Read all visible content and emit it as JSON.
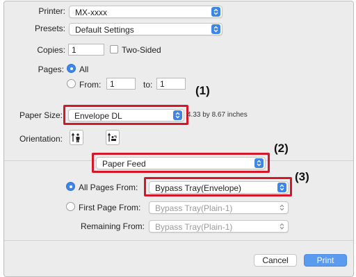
{
  "printer": {
    "label": "Printer:",
    "value": "MX-xxxx"
  },
  "presets": {
    "label": "Presets:",
    "value": "Default Settings"
  },
  "copies": {
    "label": "Copies:",
    "value": "1",
    "two_sided_label": "Two-Sided"
  },
  "pages": {
    "label": "Pages:",
    "all_label": "All",
    "from_label": "From:",
    "from_value": "1",
    "to_label": "to:",
    "to_value": "1"
  },
  "paper_size": {
    "label": "Paper Size:",
    "value": "Envelope DL",
    "dimensions": "4.33 by 8.67 inches"
  },
  "orientation": {
    "label": "Orientation:",
    "portrait_icon": "portrait-orientation-icon",
    "landscape_icon": "landscape-orientation-icon"
  },
  "section_menu": {
    "value": "Paper Feed"
  },
  "paper_feed": {
    "all_pages_label": "All Pages From:",
    "all_pages_value": "Bypass Tray(Envelope)",
    "first_page_label": "First Page From:",
    "first_page_value": "Bypass Tray(Plain-1)",
    "remaining_label": "Remaining From:",
    "remaining_value": "Bypass Tray(Plain-1)"
  },
  "callouts": {
    "c1": "(1)",
    "c2": "(2)",
    "c3": "(3)"
  },
  "buttons": {
    "cancel": "Cancel",
    "print": "Print"
  },
  "colors": {
    "accent": "#3d86e8",
    "highlight": "#d6172a",
    "background": "#ececec"
  }
}
